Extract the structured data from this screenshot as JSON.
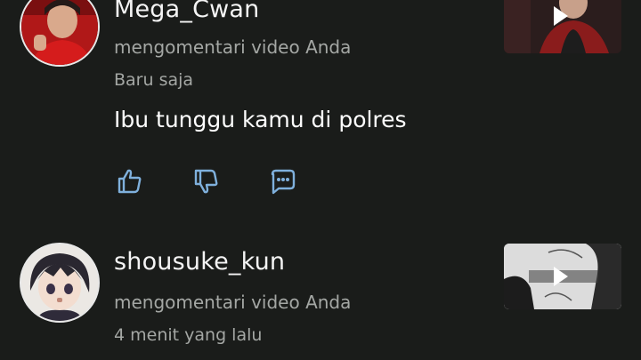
{
  "notifications": [
    {
      "username": "Mega_Cwan",
      "action": "mengomentari video Anda",
      "time": "Baru saja",
      "comment": "Ibu tunggu kamu di polres",
      "actions": [
        "like-icon",
        "dislike-icon",
        "reply-icon"
      ]
    },
    {
      "username": "shousuke_kun",
      "action": "mengomentari video Anda",
      "time": "4 menit yang lalu"
    }
  ],
  "colors": {
    "background": "#1a1c1a",
    "secondary_text": "#a4a7a4",
    "primary_text": "#ffffff",
    "icon": "#7fb0dc"
  }
}
